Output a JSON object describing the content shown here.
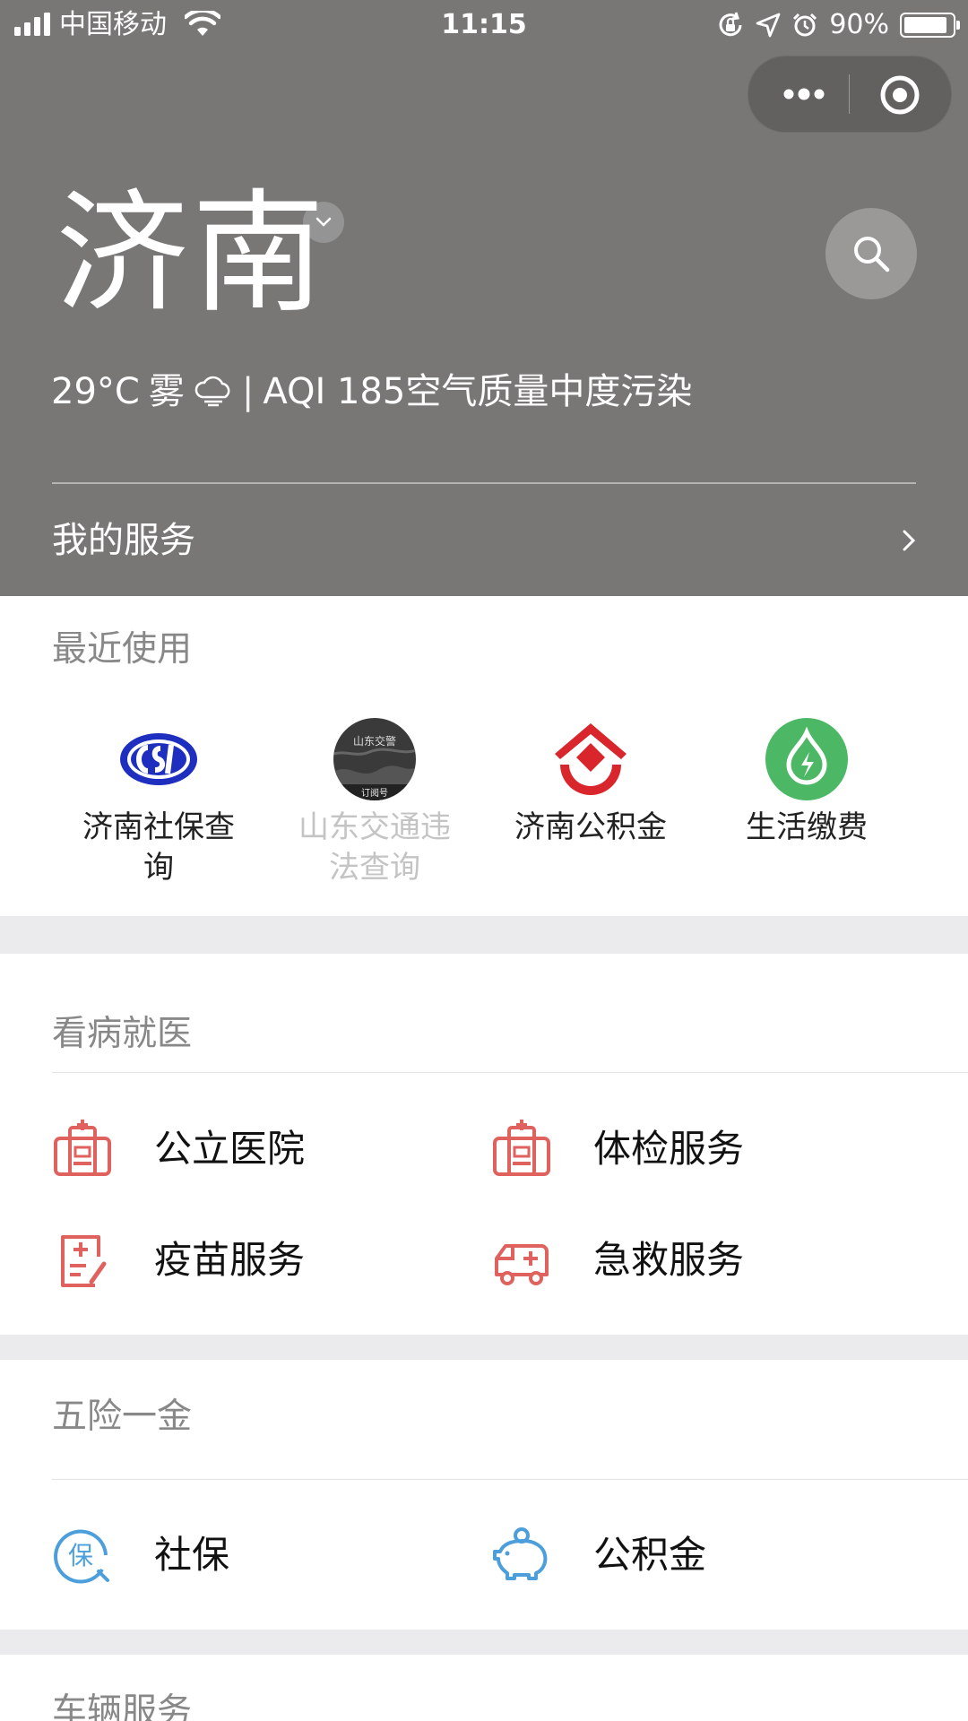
{
  "status_bar": {
    "carrier": "中国移动",
    "time": "11:15",
    "battery_percent": "90%",
    "battery_level": 0.9
  },
  "header": {
    "city": "济南",
    "weather": {
      "temperature": "29°C",
      "condition": "雾",
      "separator": "|",
      "aqi": "AQI 185空气质量中度污染"
    },
    "my_services_label": "我的服务"
  },
  "recent": {
    "title": "最近使用",
    "items": [
      {
        "label": "济南社保查询",
        "icon": "social-security-logo",
        "disabled": false
      },
      {
        "label": "山东交通违法查询",
        "icon": "shandong-traffic-logo",
        "badge": "订阅号",
        "logo_text": "山东交警",
        "disabled": true
      },
      {
        "label": "济南公积金",
        "icon": "housing-fund-logo",
        "disabled": false
      },
      {
        "label": "生活缴费",
        "icon": "bill-payment-logo",
        "disabled": false
      }
    ]
  },
  "medical": {
    "title": "看病就医",
    "items": [
      {
        "label": "公立医院",
        "icon": "hospital-icon"
      },
      {
        "label": "体检服务",
        "icon": "checkup-icon"
      },
      {
        "label": "疫苗服务",
        "icon": "vaccine-icon"
      },
      {
        "label": "急救服务",
        "icon": "ambulance-icon"
      }
    ]
  },
  "insurance": {
    "title": "五险一金",
    "items": [
      {
        "label": "社保",
        "icon": "insurance-icon",
        "icon_text": "保"
      },
      {
        "label": "公积金",
        "icon": "piggy-bank-icon"
      }
    ]
  },
  "vehicle": {
    "title": "车辆服务"
  },
  "colors": {
    "header_bg": "#787776",
    "medical_icon": "#e0625f",
    "insurance_icon": "#4c9fdb",
    "section_gap": "#ebebed"
  }
}
